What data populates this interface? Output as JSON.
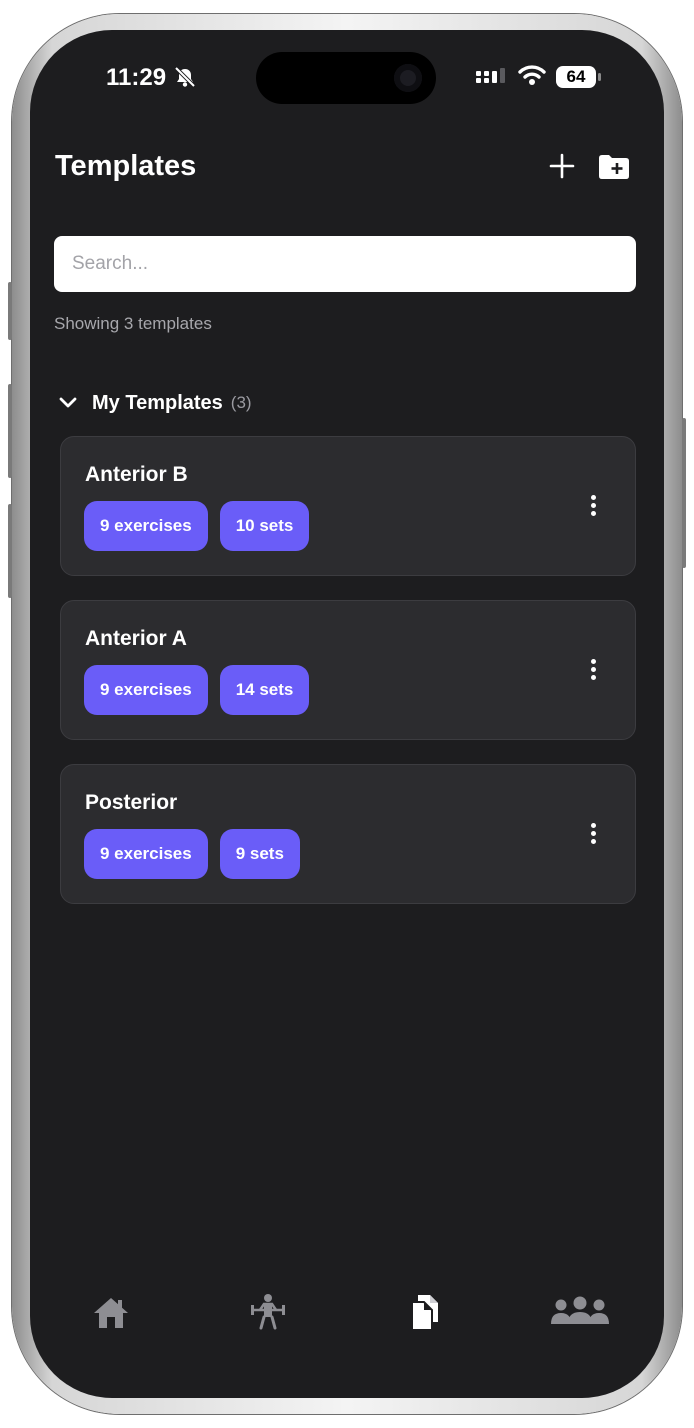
{
  "status_bar": {
    "time": "11:29",
    "battery": "64",
    "bell_icon": "bell-slash-icon",
    "signal_icon": "cellular-signal-icon",
    "wifi_icon": "wifi-icon"
  },
  "header": {
    "title": "Templates",
    "add_icon": "plus-icon",
    "new_folder_icon": "folder-plus-icon"
  },
  "search": {
    "placeholder": "Search...",
    "value": ""
  },
  "summary": {
    "text": "Showing 3 templates"
  },
  "section": {
    "title": "My Templates",
    "count": "(3)",
    "chevron_icon": "chevron-down-icon"
  },
  "templates": [
    {
      "name": "Anterior B",
      "exercises": "9 exercises",
      "sets": "10 sets"
    },
    {
      "name": "Anterior A",
      "exercises": "9 exercises",
      "sets": "14 sets"
    },
    {
      "name": "Posterior",
      "exercises": "9 exercises",
      "sets": "9 sets"
    }
  ],
  "tab_bar": {
    "tabs": [
      {
        "icon": "home-icon",
        "active": false
      },
      {
        "icon": "weightlifting-icon",
        "active": false
      },
      {
        "icon": "templates-icon",
        "active": true
      },
      {
        "icon": "social-group-icon",
        "active": false
      }
    ]
  },
  "colors": {
    "background": "#1d1d1f",
    "card": "#2c2c2f",
    "accent": "#6a5df8",
    "text": "#ffffff",
    "muted": "#a7a7ac",
    "tab_inactive": "#8e8e93"
  }
}
